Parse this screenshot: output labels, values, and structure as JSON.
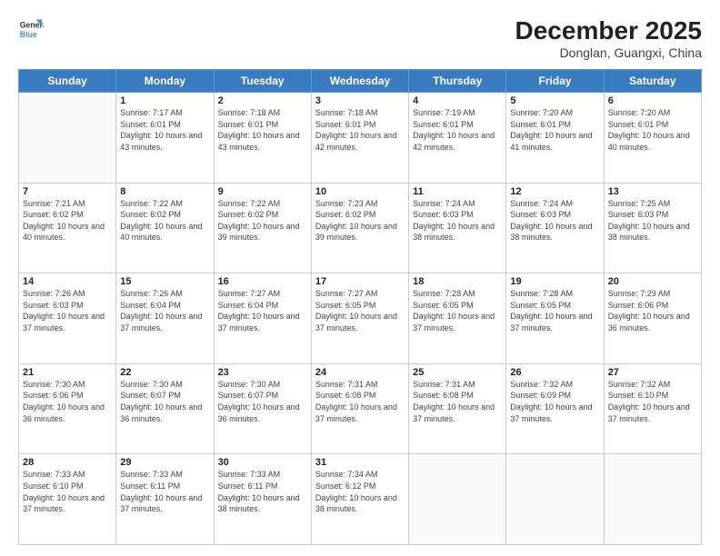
{
  "header": {
    "logo_line1": "General",
    "logo_line2": "Blue",
    "title": "December 2025",
    "subtitle": "Donglan, Guangxi, China"
  },
  "weekdays": [
    "Sunday",
    "Monday",
    "Tuesday",
    "Wednesday",
    "Thursday",
    "Friday",
    "Saturday"
  ],
  "weeks": [
    [
      {
        "day": "",
        "sunrise": "",
        "sunset": "",
        "daylight": ""
      },
      {
        "day": "1",
        "sunrise": "Sunrise: 7:17 AM",
        "sunset": "Sunset: 6:01 PM",
        "daylight": "Daylight: 10 hours and 43 minutes."
      },
      {
        "day": "2",
        "sunrise": "Sunrise: 7:18 AM",
        "sunset": "Sunset: 6:01 PM",
        "daylight": "Daylight: 10 hours and 43 minutes."
      },
      {
        "day": "3",
        "sunrise": "Sunrise: 7:18 AM",
        "sunset": "Sunset: 6:01 PM",
        "daylight": "Daylight: 10 hours and 42 minutes."
      },
      {
        "day": "4",
        "sunrise": "Sunrise: 7:19 AM",
        "sunset": "Sunset: 6:01 PM",
        "daylight": "Daylight: 10 hours and 42 minutes."
      },
      {
        "day": "5",
        "sunrise": "Sunrise: 7:20 AM",
        "sunset": "Sunset: 6:01 PM",
        "daylight": "Daylight: 10 hours and 41 minutes."
      },
      {
        "day": "6",
        "sunrise": "Sunrise: 7:20 AM",
        "sunset": "Sunset: 6:01 PM",
        "daylight": "Daylight: 10 hours and 40 minutes."
      }
    ],
    [
      {
        "day": "7",
        "sunrise": "Sunrise: 7:21 AM",
        "sunset": "Sunset: 6:02 PM",
        "daylight": "Daylight: 10 hours and 40 minutes."
      },
      {
        "day": "8",
        "sunrise": "Sunrise: 7:22 AM",
        "sunset": "Sunset: 6:02 PM",
        "daylight": "Daylight: 10 hours and 40 minutes."
      },
      {
        "day": "9",
        "sunrise": "Sunrise: 7:22 AM",
        "sunset": "Sunset: 6:02 PM",
        "daylight": "Daylight: 10 hours and 39 minutes."
      },
      {
        "day": "10",
        "sunrise": "Sunrise: 7:23 AM",
        "sunset": "Sunset: 6:02 PM",
        "daylight": "Daylight: 10 hours and 39 minutes."
      },
      {
        "day": "11",
        "sunrise": "Sunrise: 7:24 AM",
        "sunset": "Sunset: 6:03 PM",
        "daylight": "Daylight: 10 hours and 38 minutes."
      },
      {
        "day": "12",
        "sunrise": "Sunrise: 7:24 AM",
        "sunset": "Sunset: 6:03 PM",
        "daylight": "Daylight: 10 hours and 38 minutes."
      },
      {
        "day": "13",
        "sunrise": "Sunrise: 7:25 AM",
        "sunset": "Sunset: 6:03 PM",
        "daylight": "Daylight: 10 hours and 38 minutes."
      }
    ],
    [
      {
        "day": "14",
        "sunrise": "Sunrise: 7:26 AM",
        "sunset": "Sunset: 6:03 PM",
        "daylight": "Daylight: 10 hours and 37 minutes."
      },
      {
        "day": "15",
        "sunrise": "Sunrise: 7:26 AM",
        "sunset": "Sunset: 6:04 PM",
        "daylight": "Daylight: 10 hours and 37 minutes."
      },
      {
        "day": "16",
        "sunrise": "Sunrise: 7:27 AM",
        "sunset": "Sunset: 6:04 PM",
        "daylight": "Daylight: 10 hours and 37 minutes."
      },
      {
        "day": "17",
        "sunrise": "Sunrise: 7:27 AM",
        "sunset": "Sunset: 6:05 PM",
        "daylight": "Daylight: 10 hours and 37 minutes."
      },
      {
        "day": "18",
        "sunrise": "Sunrise: 7:28 AM",
        "sunset": "Sunset: 6:05 PM",
        "daylight": "Daylight: 10 hours and 37 minutes."
      },
      {
        "day": "19",
        "sunrise": "Sunrise: 7:28 AM",
        "sunset": "Sunset: 6:05 PM",
        "daylight": "Daylight: 10 hours and 37 minutes."
      },
      {
        "day": "20",
        "sunrise": "Sunrise: 7:29 AM",
        "sunset": "Sunset: 6:06 PM",
        "daylight": "Daylight: 10 hours and 36 minutes."
      }
    ],
    [
      {
        "day": "21",
        "sunrise": "Sunrise: 7:30 AM",
        "sunset": "Sunset: 6:06 PM",
        "daylight": "Daylight: 10 hours and 36 minutes."
      },
      {
        "day": "22",
        "sunrise": "Sunrise: 7:30 AM",
        "sunset": "Sunset: 6:07 PM",
        "daylight": "Daylight: 10 hours and 36 minutes."
      },
      {
        "day": "23",
        "sunrise": "Sunrise: 7:30 AM",
        "sunset": "Sunset: 6:07 PM",
        "daylight": "Daylight: 10 hours and 36 minutes."
      },
      {
        "day": "24",
        "sunrise": "Sunrise: 7:31 AM",
        "sunset": "Sunset: 6:08 PM",
        "daylight": "Daylight: 10 hours and 37 minutes."
      },
      {
        "day": "25",
        "sunrise": "Sunrise: 7:31 AM",
        "sunset": "Sunset: 6:08 PM",
        "daylight": "Daylight: 10 hours and 37 minutes."
      },
      {
        "day": "26",
        "sunrise": "Sunrise: 7:32 AM",
        "sunset": "Sunset: 6:09 PM",
        "daylight": "Daylight: 10 hours and 37 minutes."
      },
      {
        "day": "27",
        "sunrise": "Sunrise: 7:32 AM",
        "sunset": "Sunset: 6:10 PM",
        "daylight": "Daylight: 10 hours and 37 minutes."
      }
    ],
    [
      {
        "day": "28",
        "sunrise": "Sunrise: 7:33 AM",
        "sunset": "Sunset: 6:10 PM",
        "daylight": "Daylight: 10 hours and 37 minutes."
      },
      {
        "day": "29",
        "sunrise": "Sunrise: 7:33 AM",
        "sunset": "Sunset: 6:11 PM",
        "daylight": "Daylight: 10 hours and 37 minutes."
      },
      {
        "day": "30",
        "sunrise": "Sunrise: 7:33 AM",
        "sunset": "Sunset: 6:11 PM",
        "daylight": "Daylight: 10 hours and 38 minutes."
      },
      {
        "day": "31",
        "sunrise": "Sunrise: 7:34 AM",
        "sunset": "Sunset: 6:12 PM",
        "daylight": "Daylight: 10 hours and 38 minutes."
      },
      {
        "day": "",
        "sunrise": "",
        "sunset": "",
        "daylight": ""
      },
      {
        "day": "",
        "sunrise": "",
        "sunset": "",
        "daylight": ""
      },
      {
        "day": "",
        "sunrise": "",
        "sunset": "",
        "daylight": ""
      }
    ]
  ]
}
